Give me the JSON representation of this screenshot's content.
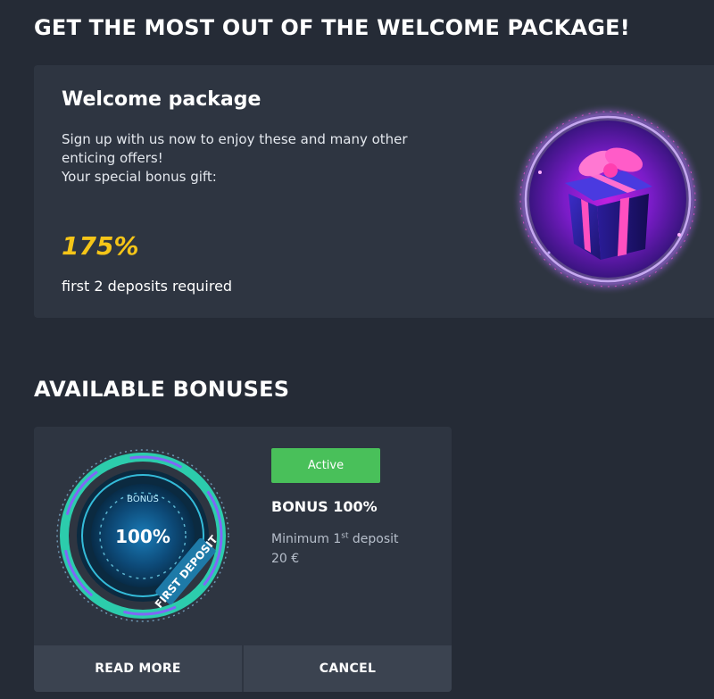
{
  "welcome_section": {
    "heading": "GET THE MOST OUT OF THE WELCOME PACKAGE!",
    "card": {
      "title": "Welcome package",
      "description_lines": [
        "Sign up with us now to enjoy these and many other",
        "enticing offers!",
        "Your special bonus gift:"
      ],
      "bonus_percent": "175%",
      "deposit_note": "first 2 deposits required",
      "image_icon": "gift-box-icon"
    }
  },
  "bonuses_section": {
    "heading": "AVAILABLE BONUSES",
    "cards": [
      {
        "badge": {
          "top_label": "BONUS",
          "percent": "100%",
          "ring_label": "FIRST DEPOSIT"
        },
        "status": "Active",
        "name": "BONUS 100%",
        "min_deposit_label": "Minimum 1",
        "min_deposit_sup": "st",
        "min_deposit_suffix": " deposit",
        "min_deposit_amount": "20 €",
        "buttons": {
          "read_more": "READ MORE",
          "cancel": "CANCEL"
        }
      }
    ]
  },
  "colors": {
    "background": "#252b36",
    "card": "#2e3541",
    "button": "#3b4350",
    "accent_yellow": "#f5c518",
    "active_green": "#49c05a"
  }
}
